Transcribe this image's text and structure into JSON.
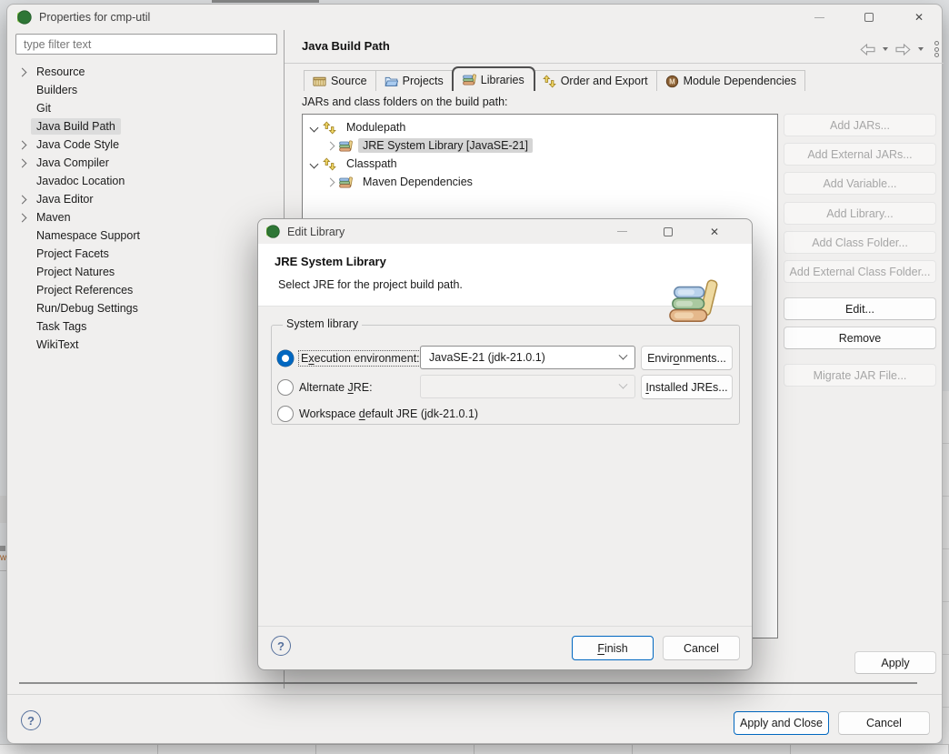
{
  "window": {
    "title": "Properties for cmp-util"
  },
  "sidebar": {
    "filter_placeholder": "type filter text",
    "items": [
      {
        "label": "Resource"
      },
      {
        "label": "Builders"
      },
      {
        "label": "Git"
      },
      {
        "label": "Java Build Path"
      },
      {
        "label": "Java Code Style"
      },
      {
        "label": "Java Compiler"
      },
      {
        "label": "Javadoc Location"
      },
      {
        "label": "Java Editor"
      },
      {
        "label": "Maven"
      },
      {
        "label": "Namespace Support"
      },
      {
        "label": "Project Facets"
      },
      {
        "label": "Project Natures"
      },
      {
        "label": "Project References"
      },
      {
        "label": "Run/Debug Settings"
      },
      {
        "label": "Task Tags"
      },
      {
        "label": "WikiText"
      }
    ]
  },
  "main": {
    "title": "Java Build Path",
    "tabs": [
      {
        "label": "Source"
      },
      {
        "label": "Projects"
      },
      {
        "label": "Libraries"
      },
      {
        "label": "Order and Export"
      },
      {
        "label": "Module Dependencies"
      }
    ],
    "tree_label": "JARs and class folders on the build path:",
    "tree": [
      {
        "label": "Modulepath"
      },
      {
        "label": "JRE System Library [JavaSE-21]"
      },
      {
        "label": "Classpath"
      },
      {
        "label": "Maven Dependencies"
      }
    ],
    "side_buttons": [
      {
        "label": "Add JARs...",
        "enabled": false
      },
      {
        "label": "Add External JARs...",
        "enabled": false
      },
      {
        "label": "Add Variable...",
        "enabled": false
      },
      {
        "label": "Add Library...",
        "enabled": false
      },
      {
        "label": "Add Class Folder...",
        "enabled": false
      },
      {
        "label": "Add External Class Folder...",
        "enabled": false
      },
      {
        "label": "Edit...",
        "enabled": true
      },
      {
        "label": "Remove",
        "enabled": true
      },
      {
        "label": "Migrate JAR File...",
        "enabled": false
      }
    ],
    "apply_label": "Apply"
  },
  "footer": {
    "apply_close_label": "Apply and Close",
    "cancel_label": "Cancel"
  },
  "dialog": {
    "title": "Edit Library",
    "heading": "JRE System Library",
    "description": "Select JRE for the project build path.",
    "group_label": "System library",
    "radios": [
      {
        "pre": "E",
        "key": "x",
        "post": "ecution environment:",
        "selected": true,
        "value": "JavaSE-21 (jdk-21.0.1)",
        "btn_pre": "Envir",
        "btn_key": "o",
        "btn_post": "nments..."
      },
      {
        "pre": "Alternate ",
        "key": "J",
        "post": "RE:",
        "selected": false,
        "value": "",
        "btn_pre": "",
        "btn_key": "I",
        "btn_post": "nstalled JREs..."
      },
      {
        "pre": "Workspace ",
        "key": "d",
        "post": "efault JRE (jdk-21.0.1)",
        "selected": false
      }
    ],
    "finish": {
      "pre": "",
      "key": "F",
      "post": "inish"
    },
    "cancel_label": "Cancel"
  },
  "colors": {
    "accent": "#0067c0",
    "selection_bg": "#dcdcdc",
    "window_bg": "#f0efee"
  },
  "icons": {
    "titlebar": "eclipse-icon",
    "tabs": [
      "package-icon",
      "open-folder-icon",
      "library-books-icon",
      "order-arrows-icon",
      "module-icon"
    ],
    "tree_nodes": [
      "updown-arrows-icon",
      "library-books-icon"
    ],
    "nav": [
      "back-arrow-icon",
      "forward-arrow-icon",
      "view-menu-icon"
    ],
    "dialog_art": "books-stack-icon",
    "help": "question-mark-icon"
  }
}
